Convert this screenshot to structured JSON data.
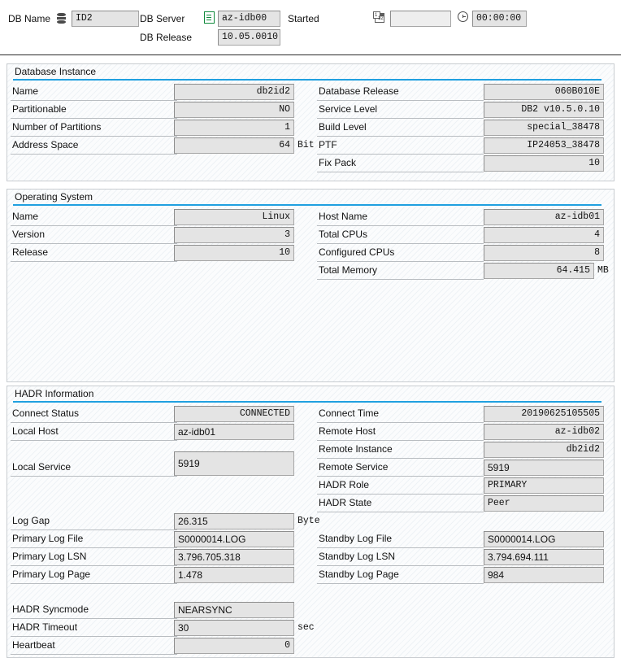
{
  "header": {
    "db_name_label": "DB Name",
    "db_name_icon": "database-icon",
    "db_name_value": "ID2",
    "db_server_label": "DB Server",
    "db_server_icon": "server-icon",
    "db_server_value": "az-idb00",
    "db_release_label": "DB Release",
    "db_release_value": "10.05.0010",
    "started_label": "Started",
    "started_date_icon": "calendar-icon",
    "started_date_value": "",
    "started_time_icon": "clock-icon",
    "started_time_value": "00:00:00"
  },
  "groups": [
    {
      "title": "Database Instance",
      "left_rows": [
        {
          "label": "Name",
          "value": "db2id2",
          "align": "right",
          "unit": ""
        },
        {
          "label": "Partitionable",
          "value": "NO",
          "align": "right",
          "unit": ""
        },
        {
          "label": "Number of Partitions",
          "value": "1",
          "align": "right",
          "unit": ""
        },
        {
          "label": "Address Space",
          "value": "64",
          "align": "right",
          "unit": "Bit"
        }
      ],
      "right_rows": [
        {
          "label": "Database Release",
          "value": "060B010E",
          "align": "right",
          "unit": ""
        },
        {
          "label": "Service Level",
          "value": "DB2 v10.5.0.10",
          "align": "right",
          "unit": ""
        },
        {
          "label": "Build Level",
          "value": "special_38478",
          "align": "right",
          "unit": ""
        },
        {
          "label": "PTF",
          "value": "IP24053_38478",
          "align": "right",
          "unit": ""
        },
        {
          "label": "Fix Pack",
          "value": "10",
          "align": "right",
          "unit": ""
        }
      ]
    },
    {
      "title": "Operating System",
      "left_rows": [
        {
          "label": "Name",
          "value": "Linux",
          "align": "right",
          "unit": ""
        },
        {
          "label": "Version",
          "value": "3",
          "align": "right",
          "unit": ""
        },
        {
          "label": "Release",
          "value": "10",
          "align": "right",
          "unit": ""
        }
      ],
      "right_rows": [
        {
          "label": "Host Name",
          "value": "az-idb01",
          "align": "right",
          "unit": ""
        },
        {
          "label": "Total CPUs",
          "value": "4",
          "align": "right",
          "unit": ""
        },
        {
          "label": "Configured CPUs",
          "value": "8",
          "align": "right",
          "unit": ""
        },
        {
          "label": "Total Memory",
          "value": "64.415",
          "align": "right",
          "unit": "MB"
        }
      ]
    },
    {
      "title": "HADR Information",
      "left_rows": [
        {
          "label": "Connect Status",
          "value": "CONNECTED",
          "align": "right",
          "unit": ""
        },
        {
          "label": "Local Host",
          "value": "az-idb01",
          "align": "left",
          "unit": ""
        },
        {
          "label": "Local Service",
          "value": "5919",
          "align": "left",
          "unit": ""
        },
        {
          "label": "Log Gap",
          "value": "26.315",
          "align": "left",
          "unit": "Byte"
        },
        {
          "label": "Primary Log File",
          "value": "S0000014.LOG",
          "align": "left",
          "unit": ""
        },
        {
          "label": "Primary Log LSN",
          "value": "3.796.705.318",
          "align": "left",
          "unit": ""
        },
        {
          "label": "Primary Log Page",
          "value": "1.478",
          "align": "left",
          "unit": ""
        },
        {
          "label": "HADR Syncmode",
          "value": "NEARSYNC",
          "align": "left",
          "unit": ""
        },
        {
          "label": "HADR Timeout",
          "value": "30",
          "align": "left",
          "unit": "sec"
        },
        {
          "label": "Heartbeat",
          "value": "0",
          "align": "right",
          "unit": ""
        }
      ],
      "right_rows": [
        {
          "label": "Connect Time",
          "value": "20190625105505",
          "align": "right",
          "unit": ""
        },
        {
          "label": "Remote Host",
          "value": "az-idb02",
          "align": "right",
          "unit": ""
        },
        {
          "label": "Remote Instance",
          "value": "db2id2",
          "align": "right",
          "unit": ""
        },
        {
          "label": "Remote Service",
          "value": "5919",
          "align": "left",
          "unit": ""
        },
        {
          "label": "HADR Role",
          "value": "PRIMARY",
          "align": "left",
          "unit": ""
        },
        {
          "label": "HADR State",
          "value": "Peer",
          "align": "left",
          "unit": ""
        },
        {
          "label": "Standby Log File",
          "value": "S0000014.LOG",
          "align": "left",
          "unit": ""
        },
        {
          "label": "Standby Log LSN",
          "value": "3.794.694.111",
          "align": "left",
          "unit": ""
        },
        {
          "label": "Standby Log Page",
          "value": "984",
          "align": "left",
          "unit": ""
        }
      ]
    }
  ],
  "colors": {
    "group_rule": "#20a0e0",
    "field_bg": "#e4e4e4",
    "server_icon": "#108a3c"
  }
}
